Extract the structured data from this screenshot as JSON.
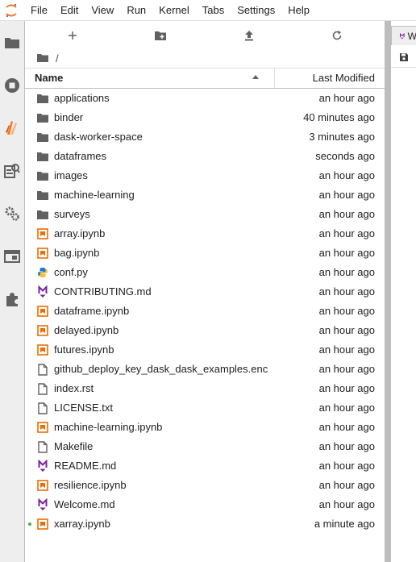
{
  "menubar": {
    "items": [
      "File",
      "Edit",
      "View",
      "Run",
      "Kernel",
      "Tabs",
      "Settings",
      "Help"
    ]
  },
  "colors": {
    "accent": "#f37726",
    "folder": "#616161",
    "notebook": "#ef6c00",
    "markdown": "#7b1fa2",
    "python": "#1976d2",
    "running_dot": "#4caf50"
  },
  "sidebar": {
    "icons": [
      "folder-icon",
      "running-icon",
      "dask-icon",
      "property-inspector-icon",
      "settings-icon",
      "tabs-icon",
      "extension-icon"
    ]
  },
  "filebrowser": {
    "toolbar": [
      "new-launcher-icon",
      "new-folder-icon",
      "upload-icon",
      "refresh-icon"
    ],
    "breadcrumb": "/",
    "columns": {
      "name": "Name",
      "modified": "Last Modified"
    },
    "files": [
      {
        "name": "applications",
        "type": "folder",
        "modified": "an hour ago"
      },
      {
        "name": "binder",
        "type": "folder",
        "modified": "40 minutes ago"
      },
      {
        "name": "dask-worker-space",
        "type": "folder",
        "modified": "3 minutes ago"
      },
      {
        "name": "dataframes",
        "type": "folder",
        "modified": "seconds ago"
      },
      {
        "name": "images",
        "type": "folder",
        "modified": "an hour ago"
      },
      {
        "name": "machine-learning",
        "type": "folder",
        "modified": "an hour ago"
      },
      {
        "name": "surveys",
        "type": "folder",
        "modified": "an hour ago"
      },
      {
        "name": "array.ipynb",
        "type": "notebook",
        "modified": "an hour ago"
      },
      {
        "name": "bag.ipynb",
        "type": "notebook",
        "modified": "an hour ago"
      },
      {
        "name": "conf.py",
        "type": "python",
        "modified": "an hour ago"
      },
      {
        "name": "CONTRIBUTING.md",
        "type": "markdown",
        "modified": "an hour ago"
      },
      {
        "name": "dataframe.ipynb",
        "type": "notebook",
        "modified": "an hour ago"
      },
      {
        "name": "delayed.ipynb",
        "type": "notebook",
        "modified": "an hour ago"
      },
      {
        "name": "futures.ipynb",
        "type": "notebook",
        "modified": "an hour ago"
      },
      {
        "name": "github_deploy_key_dask_dask_examples.enc",
        "type": "file",
        "modified": "an hour ago"
      },
      {
        "name": "index.rst",
        "type": "file",
        "modified": "an hour ago"
      },
      {
        "name": "LICENSE.txt",
        "type": "file",
        "modified": "an hour ago"
      },
      {
        "name": "machine-learning.ipynb",
        "type": "notebook",
        "modified": "an hour ago"
      },
      {
        "name": "Makefile",
        "type": "file",
        "modified": "an hour ago"
      },
      {
        "name": "README.md",
        "type": "markdown",
        "modified": "an hour ago"
      },
      {
        "name": "resilience.ipynb",
        "type": "notebook",
        "modified": "an hour ago"
      },
      {
        "name": "Welcome.md",
        "type": "markdown",
        "modified": "an hour ago"
      },
      {
        "name": "xarray.ipynb",
        "type": "notebook",
        "modified": "a minute ago",
        "running": true
      }
    ]
  },
  "rightpane": {
    "tab_label": "W"
  }
}
